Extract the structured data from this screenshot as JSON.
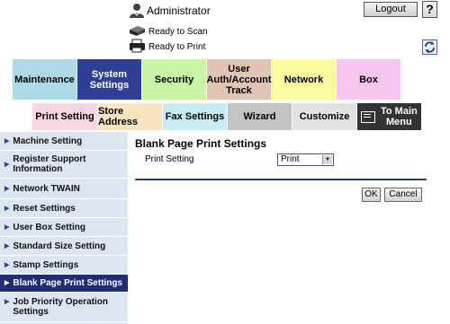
{
  "header": {
    "user_label": "Administrator",
    "logout_label": "Logout",
    "help_label": "?",
    "status": [
      {
        "label": "Ready to Scan",
        "icon": "scanner-icon"
      },
      {
        "label": "Ready to Print",
        "icon": "printer-icon"
      }
    ],
    "refresh_icon": "refresh-icon"
  },
  "main_tabs": [
    {
      "label": "Maintenance",
      "color": "#aed9e8",
      "active": false
    },
    {
      "label": "System\nSettings",
      "color": "#2f3f96",
      "active": true
    },
    {
      "label": "Security",
      "color": "#c9f4a6",
      "active": false
    },
    {
      "label": "User\nAuth/Account\nTrack",
      "color": "#e2c4b6",
      "active": false
    },
    {
      "label": "Network",
      "color": "#fafaa0",
      "active": false
    },
    {
      "label": "Box",
      "color": "#f6c5f0",
      "active": false
    }
  ],
  "sub_tabs": [
    {
      "label": "Print Setting",
      "color": "#f8d6e2"
    },
    {
      "label": "Store Address",
      "color": "#fae3c0"
    },
    {
      "label": "Fax Settings",
      "color": "#c8ecf4"
    },
    {
      "label": "Wizard",
      "color": "#c3c3c3"
    },
    {
      "label": "Customize",
      "color": "#e2e2e2"
    },
    {
      "label": "To Main\nMenu",
      "color": "#333333"
    }
  ],
  "sidebar": {
    "items": [
      {
        "label": "Machine Setting"
      },
      {
        "label": "Register Support Information"
      },
      {
        "label": "Network TWAIN"
      },
      {
        "label": "Reset Settings"
      },
      {
        "label": "User Box Setting"
      },
      {
        "label": "Standard Size Setting"
      },
      {
        "label": "Stamp Settings"
      },
      {
        "label": "Blank Page Print Settings"
      },
      {
        "label": "Job Priority Operation Settings"
      }
    ],
    "active_index": 7
  },
  "content": {
    "title": "Blank Page Print Settings",
    "print_setting_label": "Print Setting",
    "print_setting_value": "Print",
    "ok_label": "OK",
    "cancel_label": "Cancel"
  }
}
